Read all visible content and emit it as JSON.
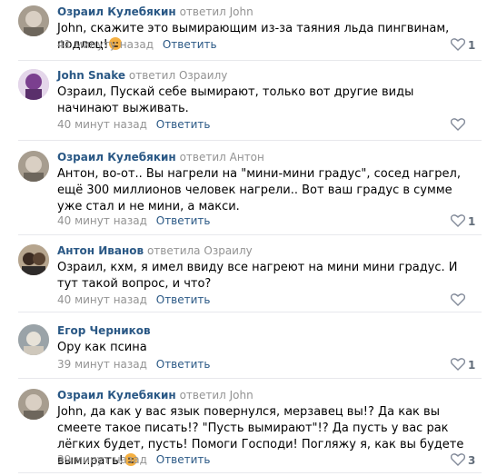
{
  "comments": [
    {
      "author": "Озраил Кулебякин",
      "replied": "ответил",
      "target": "John",
      "text": "John, скажите это вымирающим из-за таяния льда пингвинам, подлец!",
      "has_emoji": true,
      "time": "41 минуту назад",
      "reply_label": "Ответить",
      "likes": "1",
      "avatar_icon": "avatar-icon"
    },
    {
      "author": "John Snake",
      "replied": "ответил",
      "target": "Озраилу",
      "text": "Озраил, Пускай себе вымирают, только вот другие виды начинают выживать.",
      "has_emoji": false,
      "time": "40 минут назад",
      "reply_label": "Ответить",
      "likes": "",
      "avatar_icon": "avatar-icon"
    },
    {
      "author": "Озраил Кулебякин",
      "replied": "ответил",
      "target": "Антон",
      "text": "Антон, во-от.. Вы нагрели на \"мини-мини градус\", сосед нагрел, ещё 300 миллионов человек нагрели.. Вот ваш градус в сумме уже стал и не мини, а макси.",
      "has_emoji": false,
      "time": "40 минут назад",
      "reply_label": "Ответить",
      "likes": "1",
      "avatar_icon": "avatar-icon"
    },
    {
      "author": "Антон Иванов",
      "replied": "ответила",
      "target": "Озраилу",
      "text": "Озраил, кхм, я имел ввиду все нагреют на мини мини градус. И тут такой вопрос, и что?",
      "has_emoji": false,
      "time": "40 минут назад",
      "reply_label": "Ответить",
      "likes": "",
      "avatar_icon": "avatar-icon"
    },
    {
      "author": "Егор Черников",
      "replied": "",
      "target": "",
      "text": "Ору как псина",
      "has_emoji": false,
      "time": "39 минут назад",
      "reply_label": "Ответить",
      "likes": "1",
      "avatar_icon": "avatar-icon"
    },
    {
      "author": "Озраил Кулебякин",
      "replied": "ответил",
      "target": "John",
      "text": "John, да как у вас язык повернулся, мерзавец вы!? Да как вы смеете такое писать!? \"Пусть вымирают\"!? Да пусть у вас рак лёгких будет, пусть! Помоги Господи! Погляжу я, как вы будете вымирать!",
      "has_emoji": true,
      "time": "39 минут назад",
      "reply_label": "Ответить",
      "likes": "3",
      "avatar_icon": "avatar-icon"
    }
  ],
  "colors": {
    "link": "#2a5885",
    "muted": "#939393",
    "divider": "#e7e8ec",
    "like": "#828a99"
  }
}
